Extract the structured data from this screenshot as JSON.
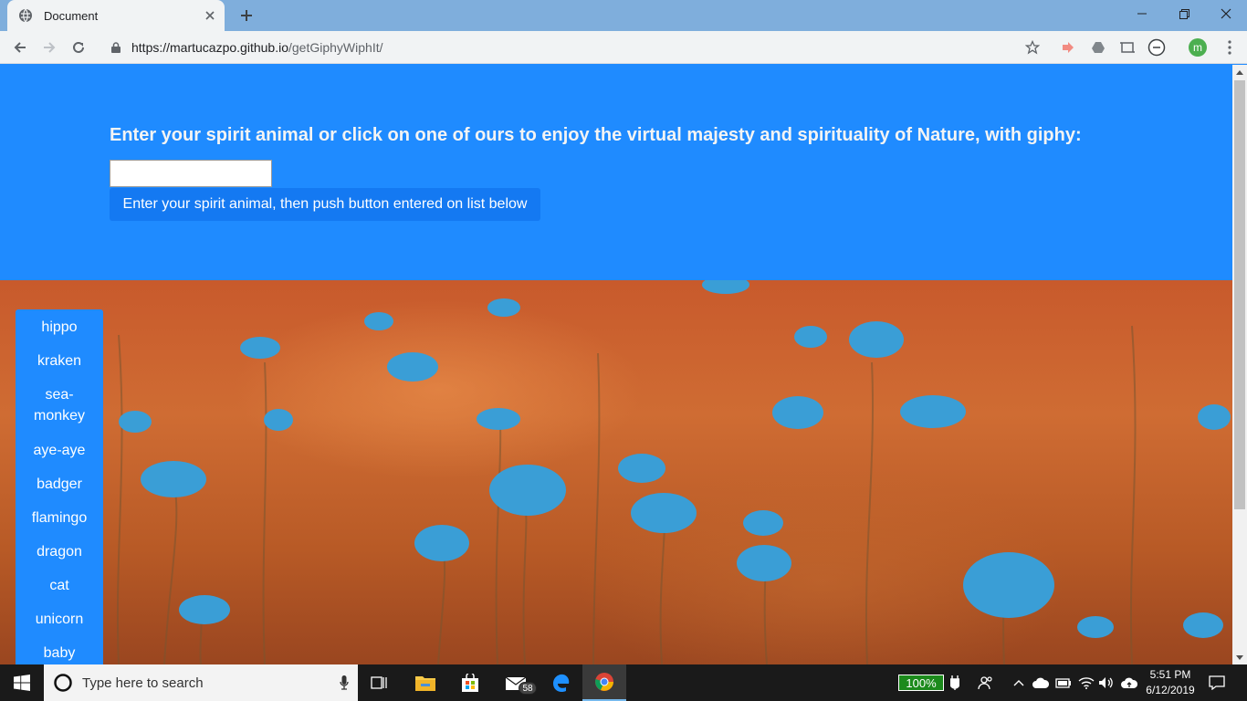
{
  "browser": {
    "tab_title": "Document",
    "url_host": "https://martucazpo.github.io",
    "url_path": "/getGiphyWiphIt/",
    "profile_initial": "m"
  },
  "page": {
    "prompt": "Enter your spirit animal or click on one of ours to enjoy the virtual majesty and spirituality of Nature, with giphy:",
    "input_value": "",
    "submit_label": "Enter your spirit animal, then push button entered on list below",
    "animals": [
      "hippo",
      "kraken",
      "sea-monkey",
      "aye-aye",
      "badger",
      "flamingo",
      "dragon",
      "cat",
      "unicorn",
      "baby"
    ]
  },
  "taskbar": {
    "search_placeholder": "Type here to search",
    "mail_badge": "58",
    "battery": "100%",
    "time": "5:51 PM",
    "date": "6/12/2019"
  },
  "colors": {
    "page_blue": "#1f8bff",
    "button_blue": "#1479f2",
    "tab_strip": "#7faedc"
  },
  "icons": [
    "globe-icon",
    "close-icon",
    "plus-icon",
    "minimize-icon",
    "restore-icon",
    "back-icon",
    "forward-icon",
    "reload-icon",
    "lock-icon",
    "star-icon",
    "windows-icon",
    "mic-icon",
    "task-view-icon",
    "folder-icon",
    "store-icon",
    "mail-icon",
    "edge-icon",
    "chrome-icon",
    "power-plug-icon",
    "people-icon",
    "chevron-up-icon",
    "cloud-icon",
    "battery-icon",
    "wifi-icon",
    "volume-icon",
    "notification-icon"
  ]
}
